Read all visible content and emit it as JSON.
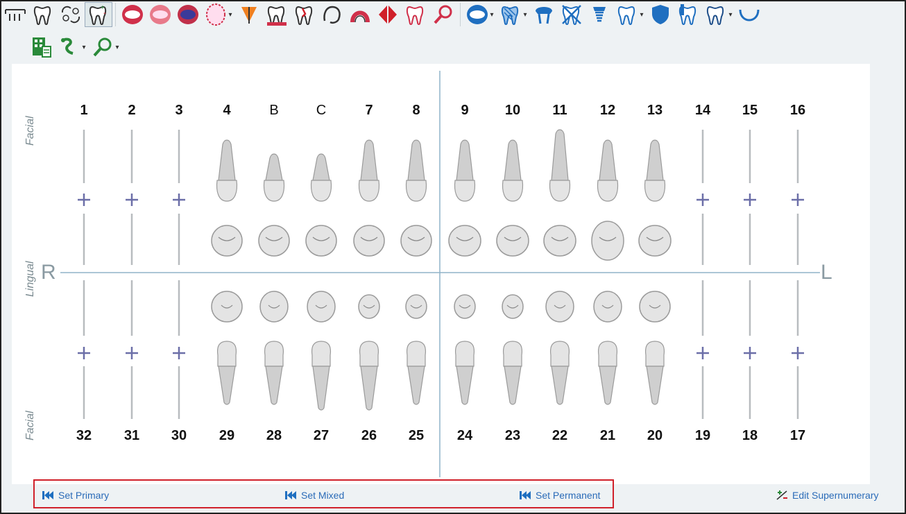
{
  "toolbar": {
    "row1": [
      {
        "icon": "bridge-icon"
      },
      {
        "icon": "tooth-icon"
      },
      {
        "icon": "swap-teeth-icon"
      },
      {
        "icon": "tooth-add-remove-icon",
        "active": true
      },
      {
        "icon": "mouth-open-icon"
      },
      {
        "icon": "mouth-upper-icon"
      },
      {
        "icon": "mouth-both-icon"
      },
      {
        "icon": "dentition-icon",
        "dropdown": true
      },
      {
        "icon": "triangle-marker-icon"
      },
      {
        "icon": "tooth-gum-icon"
      },
      {
        "icon": "tooth-fracture-icon"
      },
      {
        "icon": "tooth-outline-icon"
      },
      {
        "icon": "tooth-root-red-icon"
      },
      {
        "icon": "split-tooth-icon"
      },
      {
        "icon": "tooth-pink-icon"
      },
      {
        "icon": "magnifier-red-icon"
      },
      {
        "icon": "mouth-blue-icon",
        "dropdown": true
      },
      {
        "icon": "tooth-striped-icon",
        "dropdown": true
      },
      {
        "icon": "crown-blue-icon"
      },
      {
        "icon": "tooth-crossed-icon"
      },
      {
        "icon": "implant-icon"
      },
      {
        "icon": "tooth-blue-outline-icon",
        "dropdown": true
      },
      {
        "icon": "shield-icon"
      },
      {
        "icon": "tooth-post-icon"
      },
      {
        "icon": "tooth-dark-icon",
        "dropdown": true
      },
      {
        "icon": "arch-icon"
      }
    ],
    "row2": [
      {
        "icon": "chart-grid-icon"
      },
      {
        "icon": "green-tool-icon",
        "dropdown": true
      },
      {
        "icon": "magnifier-green-icon",
        "dropdown": true
      }
    ]
  },
  "chart": {
    "labels": {
      "facial_top": "Facial",
      "lingual": "Lingual",
      "facial_bottom": "Facial",
      "right": "R",
      "left": "L"
    },
    "upper_numbers": [
      "1",
      "2",
      "3",
      "4",
      "B",
      "C",
      "7",
      "8",
      "9",
      "10",
      "11",
      "12",
      "13",
      "14",
      "15",
      "16"
    ],
    "lower_numbers": [
      "32",
      "31",
      "30",
      "29",
      "28",
      "27",
      "26",
      "25",
      "24",
      "23",
      "22",
      "21",
      "20",
      "19",
      "18",
      "17"
    ],
    "upper_present": [
      false,
      false,
      false,
      true,
      true,
      true,
      true,
      true,
      true,
      true,
      true,
      true,
      true,
      false,
      false,
      false
    ],
    "lower_present": [
      false,
      false,
      false,
      true,
      true,
      true,
      true,
      true,
      true,
      true,
      true,
      true,
      true,
      false,
      false,
      false
    ],
    "primary_labels": [
      "B",
      "C"
    ]
  },
  "footer": {
    "set_primary": "Set Primary",
    "set_mixed": "Set Mixed",
    "set_permanent": "Set Permanent",
    "edit_supernumerary": "Edit Supernumerary"
  },
  "colors": {
    "accent_blue": "#1f6fc0",
    "accent_red": "#d0202a",
    "plus_purple": "#6c6fa8",
    "guide_gray": "#b8bcbf",
    "midline": "#8fb3c9"
  }
}
